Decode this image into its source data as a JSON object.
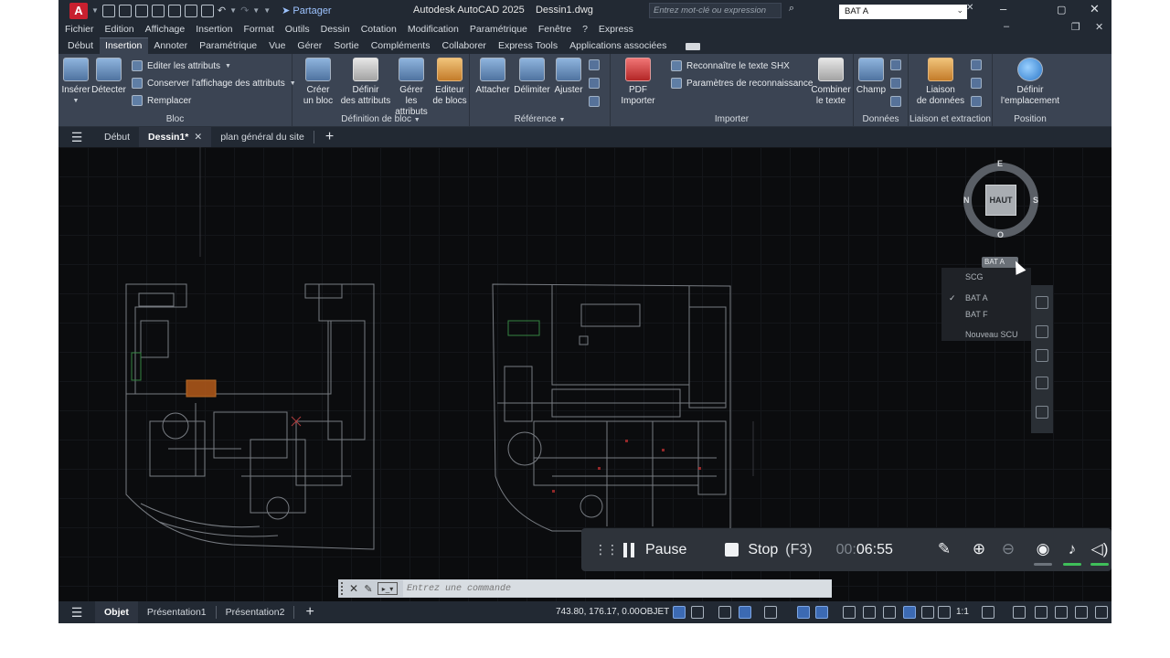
{
  "titlebar": {
    "app_logo": "A",
    "share": "Partager",
    "title": "Autodesk AutoCAD 2025",
    "filename": "Dessin1.dwg",
    "search_placeholder": "Entrez mot-clé ou expression",
    "ucs_select": "BAT A",
    "minimize": "–",
    "maximize": "▢",
    "close": "✕"
  },
  "menubar": {
    "items": [
      "Fichier",
      "Edition",
      "Affichage",
      "Insertion",
      "Format",
      "Outils",
      "Dessin",
      "Cotation",
      "Modification",
      "Paramétrique",
      "Fenêtre",
      "?",
      "Express"
    ]
  },
  "ribbon_tabs": [
    "Début",
    "Insertion",
    "Annoter",
    "Paramétrique",
    "Vue",
    "Gérer",
    "Sortie",
    "Compléments",
    "Collaborer",
    "Express Tools",
    "Applications associées"
  ],
  "ribbon_tabs_active": "Insertion",
  "ribbon": {
    "bloc": {
      "label": "Bloc",
      "inserer": "Insérer",
      "detecter": "Détecter",
      "editer_attributs": "Editer les attributs",
      "conserver_affichage": "Conserver l'affichage des attributs",
      "remplacer": "Remplacer"
    },
    "definition": {
      "label": "Définition de bloc",
      "creer_1": "Créer",
      "creer_2": "un bloc",
      "definir_1": "Définir",
      "definir_2": "des attributs",
      "gerer_1": "Gérer les",
      "gerer_2": "attributs",
      "editeur_1": "Editeur",
      "editeur_2": "de blocs"
    },
    "reference": {
      "label": "Référence",
      "attacher": "Attacher",
      "delimiter": "Délimiter",
      "ajuster": "Ajuster"
    },
    "importer": {
      "label": "Importer",
      "pdf_1": "PDF",
      "pdf_2": "Importer",
      "reconnaitre": "Reconnaître le texte SHX",
      "parametres": "Paramètres de reconnaissance",
      "combiner_1": "Combiner",
      "combiner_2": "le texte"
    },
    "donnees": {
      "label": "Données",
      "champ": "Champ"
    },
    "liaison": {
      "label": "Liaison et extraction",
      "liaison_1": "Liaison",
      "liaison_2": "de données"
    },
    "position": {
      "label": "Position",
      "definir_1": "Définir",
      "definir_2": "l'emplacement"
    }
  },
  "file_tabs": {
    "items": [
      "Début",
      "Dessin1*",
      "plan général du site"
    ],
    "active": "Dessin1*"
  },
  "viewcube": {
    "face": "HAUT",
    "north": "E",
    "west": "N",
    "east": "S",
    "south": "O"
  },
  "ucs_dropdown": {
    "pill": "BAT A",
    "items": [
      "SCG",
      "BAT A",
      "BAT F",
      "Nouveau SCU"
    ],
    "checked": "BAT A"
  },
  "command_line": {
    "placeholder": "Entrez une commande"
  },
  "statusbar": {
    "tabs": [
      "Objet",
      "Présentation1",
      "Présentation2"
    ],
    "active": "Objet",
    "coords": "743.80, 176.17, 0.00",
    "mode": "OBJET",
    "scale": "1:1"
  },
  "recorder": {
    "pause": "Pause",
    "stop": "Stop",
    "stop_key": "(F3)",
    "time_dim": "00:",
    "time": "06:55"
  },
  "colors": {
    "canvas": "#0b0c0e",
    "ribbon": "#3b4453",
    "chrome": "#222933",
    "accent": "#3c6ab3"
  }
}
